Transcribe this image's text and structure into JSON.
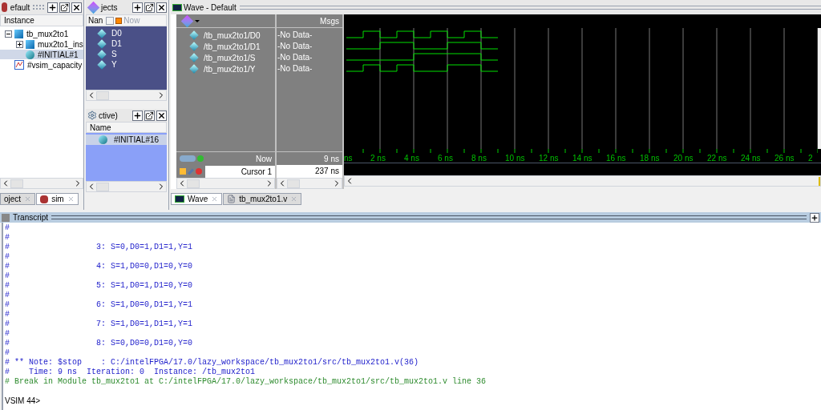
{
  "sim_panel": {
    "title": "efault",
    "column": "Instance",
    "tree": [
      {
        "label": "tb_mux2to1",
        "kind": "module",
        "expanded": true,
        "selected": false,
        "children": [
          {
            "label": "mux2to1_ins",
            "kind": "module",
            "expanded": false,
            "selected": false
          },
          {
            "label": "#INITIAL#1",
            "kind": "process",
            "selected": true
          }
        ]
      },
      {
        "label": "#vsim_capacity",
        "kind": "capacity",
        "selected": false
      }
    ],
    "tabs": [
      {
        "label": "oject",
        "selected": false
      },
      {
        "label": "sim",
        "selected": true
      }
    ]
  },
  "objects_panel": {
    "title": "jects",
    "column": "Nan",
    "now_label": "Now",
    "items": [
      "D0",
      "D1",
      "S",
      "Y"
    ]
  },
  "processes_panel": {
    "title": "ctive)",
    "column": "Name",
    "items": [
      {
        "label": "#INITIAL#16",
        "selected": true
      }
    ]
  },
  "wave_window": {
    "title": "Wave - Default",
    "msgs_header": "Msgs",
    "signals": [
      {
        "name": "/tb_mux2to1/D0",
        "value": "-No Data-"
      },
      {
        "name": "/tb_mux2to1/D1",
        "value": "-No Data-"
      },
      {
        "name": "/tb_mux2to1/S",
        "value": "-No Data-"
      },
      {
        "name": "/tb_mux2to1/Y",
        "value": "-No Data-"
      }
    ],
    "now": {
      "label": "Now",
      "value": "9 ns"
    },
    "cursor": {
      "label": "Cursor 1",
      "value": "237 ns"
    },
    "time_labels": [
      "ns",
      "2 ns",
      "4 ns",
      "6 ns",
      "8 ns",
      "10 ns",
      "12 ns",
      "14 ns",
      "16 ns",
      "18 ns",
      "20 ns",
      "22 ns",
      "24 ns",
      "26 ns",
      "2"
    ],
    "tabs": [
      {
        "label": "Wave",
        "selected": true
      },
      {
        "label": "tb_mux2to1.v",
        "selected": false
      }
    ]
  },
  "transcript": {
    "title": "Transcript",
    "lines": [
      {
        "kind": "comment",
        "text": "#"
      },
      {
        "kind": "comment",
        "text": "#"
      },
      {
        "kind": "comment",
        "text": "#                  3: S=0,D0=1,D1=1,Y=1"
      },
      {
        "kind": "comment",
        "text": "#"
      },
      {
        "kind": "comment",
        "text": "#                  4: S=1,D0=0,D1=0,Y=0"
      },
      {
        "kind": "comment",
        "text": "#"
      },
      {
        "kind": "comment",
        "text": "#                  5: S=1,D0=1,D1=0,Y=0"
      },
      {
        "kind": "comment",
        "text": "#"
      },
      {
        "kind": "comment",
        "text": "#                  6: S=1,D0=0,D1=1,Y=1"
      },
      {
        "kind": "comment",
        "text": "#"
      },
      {
        "kind": "comment",
        "text": "#                  7: S=1,D0=1,D1=1,Y=1"
      },
      {
        "kind": "comment",
        "text": "#"
      },
      {
        "kind": "comment",
        "text": "#                  8: S=0,D0=0,D1=0,Y=0"
      },
      {
        "kind": "comment",
        "text": "#"
      },
      {
        "kind": "comment",
        "text": "# ** Note: $stop    : C:/intelFPGA/17.0/lazy_workspace/tb_mux2to1/src/tb_mux2to1.v(36)"
      },
      {
        "kind": "comment",
        "text": "#    Time: 9 ns  Iteration: 0  Instance: /tb_mux2to1"
      },
      {
        "kind": "break",
        "text": "# Break in Module tb_mux2to1 at C:/intelFPGA/17.0/lazy_workspace/tb_mux2to1/src/tb_mux2to1.v line 36"
      }
    ],
    "prompt": "VSIM 44>"
  }
}
